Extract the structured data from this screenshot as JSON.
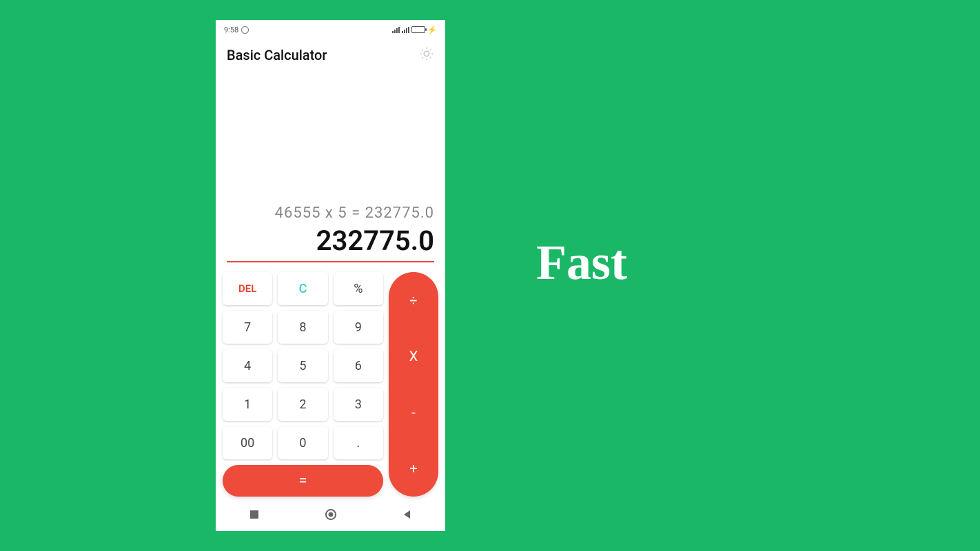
{
  "status": {
    "time": "9:58",
    "charging_glyph": "⚡"
  },
  "app": {
    "title": "Basic Calculator"
  },
  "display": {
    "expression": "46555  x  5  = 232775.0",
    "result": "232775.0"
  },
  "keys": {
    "del": "DEL",
    "clear": "C",
    "percent": "%",
    "n7": "7",
    "n8": "8",
    "n9": "9",
    "n4": "4",
    "n5": "5",
    "n6": "6",
    "n1": "1",
    "n2": "2",
    "n3": "3",
    "n00": "00",
    "n0": "0",
    "dot": ".",
    "equals": "="
  },
  "ops": {
    "divide": "÷",
    "multiply": "X",
    "minus": "-",
    "plus": "+"
  },
  "promo": {
    "text": "Fast"
  },
  "colors": {
    "bg": "#1ab866",
    "accent": "#ee4b3a",
    "clear": "#3bd1bf"
  }
}
